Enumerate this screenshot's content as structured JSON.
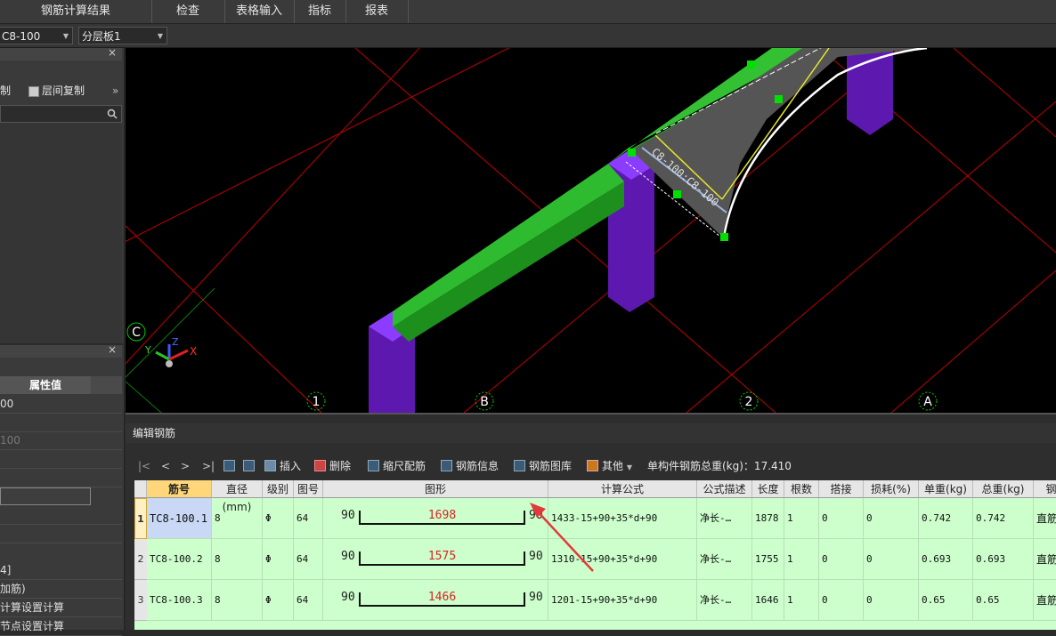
{
  "menubar": {
    "items": [
      "钢筋计算结果",
      "检查",
      "表格输入",
      "指标",
      "报表"
    ]
  },
  "selectbar": {
    "component": "C8-100",
    "layer": "分层板1"
  },
  "leftpanel": {
    "copy_label": "制",
    "floor_copy_label": "层间复制",
    "more": "»",
    "prop_header": "属性值",
    "rows": [
      "00",
      "",
      "100",
      "",
      "",
      "",
      "",
      "",
      "4]",
      "加筋)",
      "计算设置计算",
      "节点设置计算"
    ]
  },
  "viewport": {
    "grid_labels": [
      "C",
      "1",
      "B",
      "2",
      "A"
    ],
    "axis": {
      "x": "X",
      "y": "Y",
      "z": "Z"
    },
    "dim_text": "C8-100:C8-100"
  },
  "editor": {
    "title": "编辑钢筋",
    "nav": [
      "|<",
      "<",
      ">",
      ">|"
    ],
    "tools": {
      "insert": "插入",
      "delete": "删除",
      "scale": "缩尺配筋",
      "info": "钢筋信息",
      "library": "钢筋图库",
      "other": "其他",
      "total": "单构件钢筋总重(kg)：17.410"
    },
    "columns": [
      "筋号",
      "直径(mm)",
      "级别",
      "图号",
      "图形",
      "计算公式",
      "公式描述",
      "长度",
      "根数",
      "搭接",
      "损耗(%)",
      "单重(kg)",
      "总重(kg)",
      "钢"
    ],
    "rows": [
      {
        "num": "1",
        "id": "TC8-100.1",
        "dia": "8",
        "grade": "Φ",
        "fig": "64",
        "left": "90",
        "mid": "1698",
        "right": "90",
        "formula": "1433-15+90+35*d+90",
        "desc": "净长-…",
        "len": "1878",
        "count": "1",
        "lap": "0",
        "loss": "0",
        "unit": "0.742",
        "total": "0.742",
        "type": "直筋"
      },
      {
        "num": "2",
        "id": "TC8-100.2",
        "dia": "8",
        "grade": "Φ",
        "fig": "64",
        "left": "90",
        "mid": "1575",
        "right": "90",
        "formula": "1310-15+90+35*d+90",
        "desc": "净长-…",
        "len": "1755",
        "count": "1",
        "lap": "0",
        "loss": "0",
        "unit": "0.693",
        "total": "0.693",
        "type": "直筋"
      },
      {
        "num": "3",
        "id": "TC8-100.3",
        "dia": "8",
        "grade": "Φ",
        "fig": "64",
        "left": "90",
        "mid": "1466",
        "right": "90",
        "formula": "1201-15+90+35*d+90",
        "desc": "净长-…",
        "len": "1646",
        "count": "1",
        "lap": "0",
        "loss": "0",
        "unit": "0.65",
        "total": "0.65",
        "type": "直筋"
      }
    ]
  },
  "colors": {
    "table_bg": "#ccffcc",
    "beam": "#33c033",
    "column": "#6a1fc0",
    "grid_line": "#c00000"
  }
}
